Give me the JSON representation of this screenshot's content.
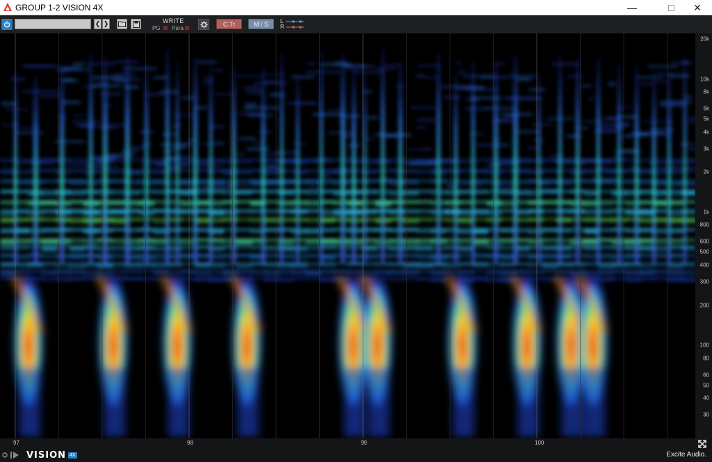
{
  "window": {
    "title": "GROUP 1-2 VISION 4X"
  },
  "toolbar": {
    "preset_value": "",
    "write_label": "WRITE",
    "pg_label": "PG",
    "para_label": "Para",
    "ctr_label": "C.Tr",
    "ms_label": "M / S",
    "l_label": "L",
    "r_label": "R"
  },
  "freq_axis": {
    "ticks": [
      {
        "label": "20k",
        "hz": 20000
      },
      {
        "label": "10k",
        "hz": 10000
      },
      {
        "label": "8k",
        "hz": 8000
      },
      {
        "label": "6k",
        "hz": 6000
      },
      {
        "label": "5k",
        "hz": 5000
      },
      {
        "label": "4k",
        "hz": 4000
      },
      {
        "label": "3k",
        "hz": 3000
      },
      {
        "label": "2k",
        "hz": 2000
      },
      {
        "label": "1k",
        "hz": 1000
      },
      {
        "label": "800",
        "hz": 800
      },
      {
        "label": "600",
        "hz": 600
      },
      {
        "label": "500",
        "hz": 500
      },
      {
        "label": "400",
        "hz": 400
      },
      {
        "label": "300",
        "hz": 300
      },
      {
        "label": "200",
        "hz": 200
      },
      {
        "label": "100",
        "hz": 100
      },
      {
        "label": "80",
        "hz": 80
      },
      {
        "label": "60",
        "hz": 60
      },
      {
        "label": "50",
        "hz": 50
      },
      {
        "label": "40",
        "hz": 40
      },
      {
        "label": "30",
        "hz": 30
      }
    ]
  },
  "time_axis": {
    "ticks": [
      {
        "label": "97",
        "bar": 97
      },
      {
        "label": "98",
        "bar": 98
      },
      {
        "label": "99",
        "bar": 99
      },
      {
        "label": "100",
        "bar": 100
      }
    ]
  },
  "footer": {
    "brand": "VISION",
    "badge": "4X",
    "company": "Excite Audio."
  },
  "colors": {
    "accent": "#2a7fc2",
    "ctr": "#b06060",
    "ms": "#7a8ea8",
    "background": "#000000"
  }
}
